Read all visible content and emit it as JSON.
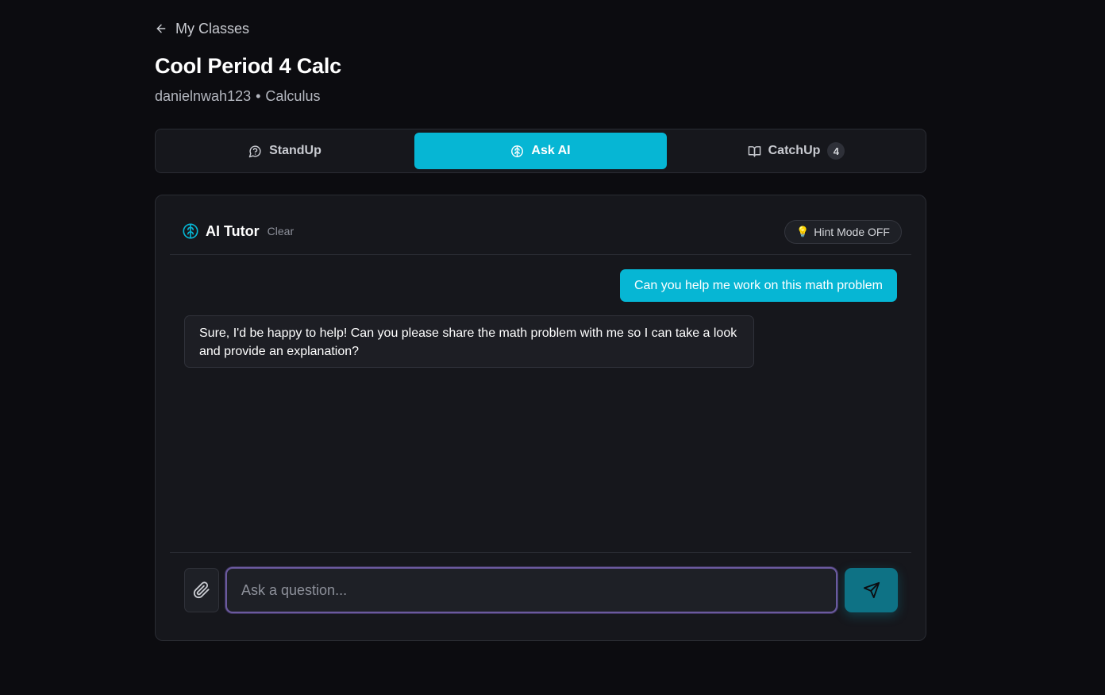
{
  "nav": {
    "back_label": "My Classes"
  },
  "class": {
    "title": "Cool Period 4 Calc",
    "teacher": "danielnwah123",
    "separator": "•",
    "subject": "Calculus"
  },
  "tabs": [
    {
      "label": "StandUp",
      "icon": "chat-bubble-help-icon",
      "active": false
    },
    {
      "label": "Ask AI",
      "icon": "brain-icon",
      "active": true
    },
    {
      "label": "CatchUp",
      "icon": "open-book-icon",
      "active": false,
      "badge": "4"
    }
  ],
  "chat": {
    "title": "AI Tutor",
    "clear_label": "Clear",
    "hint_label": "Hint Mode OFF",
    "hint_icon": "💡",
    "messages": [
      {
        "role": "user",
        "text": "Can you help me work on this math problem"
      },
      {
        "role": "ai",
        "text": "Sure, I'd be happy to help! Can you please share the math problem with me so I can take a look and provide an explanation?"
      }
    ],
    "input_placeholder": "Ask a question..."
  },
  "colors": {
    "accent": "#06b6d4",
    "background": "#0c0c10",
    "card": "#16171c",
    "input_focus": "#6b5a9e"
  }
}
